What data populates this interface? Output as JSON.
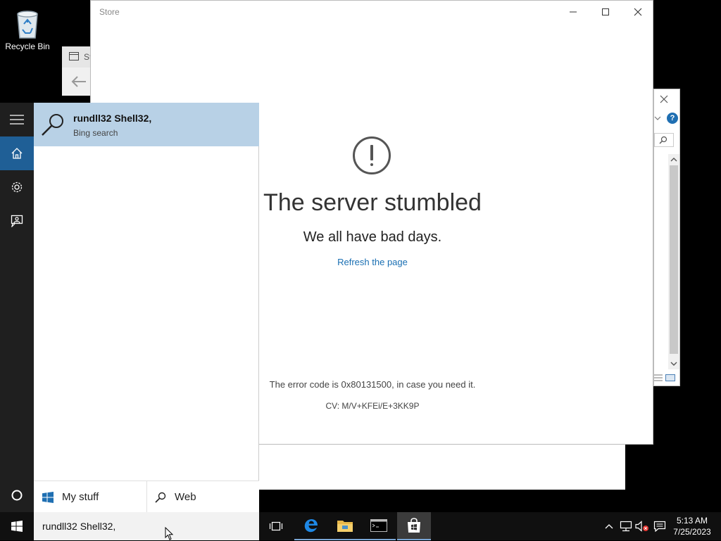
{
  "desktop": {
    "recycle_bin_label": "Recycle Bin"
  },
  "background_window": {
    "tab_label_fragment": "St"
  },
  "store": {
    "title": "Store",
    "error_title": "The server stumbled",
    "error_subtitle": "We all have bad days.",
    "refresh_link": "Refresh the page",
    "error_code_text": "The error code is 0x80131500, in case you need it.",
    "cv_text": "CV: M/V+KFEi/E+3KK9P"
  },
  "search": {
    "result_title": "rundll32 Shell32,",
    "result_subtitle": "Bing search",
    "filter_mystuff": "My stuff",
    "filter_web": "Web",
    "query": "rundll32 Shell32,"
  },
  "clock": {
    "time": "5:13 AM",
    "date": "7/25/2023"
  },
  "colors": {
    "accent": "#1f6fb2",
    "result_highlight": "#b8d1e6",
    "link": "#1a6fb3"
  }
}
